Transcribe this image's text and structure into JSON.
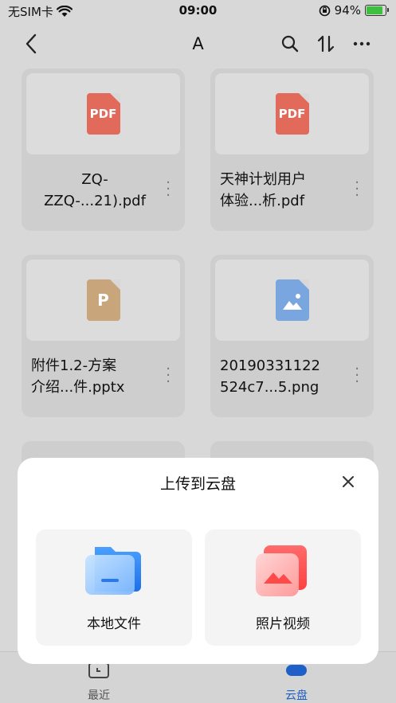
{
  "status_bar": {
    "carrier": "无SIM卡",
    "time": "09:00",
    "battery": "94%"
  },
  "nav": {
    "title": "A"
  },
  "files": [
    {
      "name": "ZQ-ZZQ-...21).pdf",
      "line1": "ZQ-",
      "line2": "ZZQ-...21).pdf",
      "type": "PDF"
    },
    {
      "name": "天神计划用户体验...析.pdf",
      "line1": "天神计划用户",
      "line2": "体验...析.pdf",
      "type": "PDF"
    },
    {
      "name": "附件1.2-方案介绍...件.pptx",
      "line1": "附件1.2-方案",
      "line2": "介绍...件.pptx",
      "type": "P"
    },
    {
      "name": "20190331122524c7...5.png",
      "line1": "20190331122",
      "line2": "524c7...5.png",
      "type": "image"
    }
  ],
  "tabbar": {
    "recent": "最近",
    "cloud": "云盘"
  },
  "sheet": {
    "title": "上传到云盘",
    "local_files": "本地文件",
    "photos_videos": "照片视频"
  },
  "colors": {
    "pdf": "#e26a5a",
    "ppt": "#c8a57a",
    "image": "#7aa6e0",
    "accent": "#2f7cf6"
  }
}
